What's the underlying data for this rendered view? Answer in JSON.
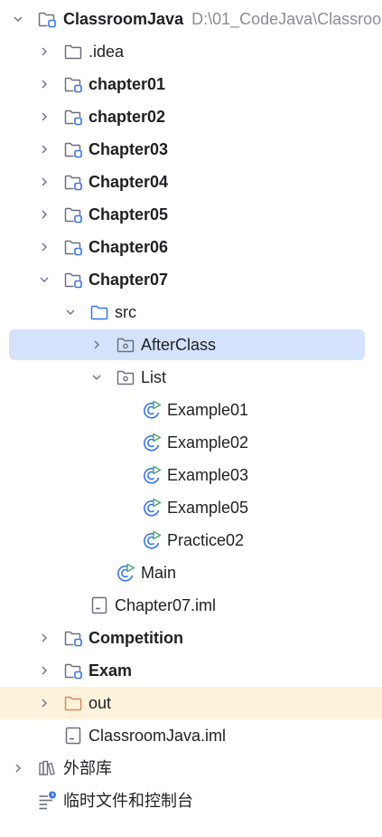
{
  "colors": {
    "selection": "#d4e2fb",
    "excluded_bg": "#fdf3dc",
    "folder_stroke": "#6c707e",
    "module_badge": "#3574f0",
    "excluded_folder": "#e08855",
    "run_class": "#3574f0",
    "run_triangle": "#55a76a",
    "path_text": "#8a8d93"
  },
  "project_tree": {
    "root": {
      "label": "ClassroomJava",
      "path": "D:\\01_CodeJava\\Classroo",
      "icon": "module-folder-icon"
    },
    "folder_idea": {
      "label": ".idea",
      "icon": "folder-icon"
    },
    "chapter01": {
      "label": "chapter01",
      "icon": "module-folder-icon"
    },
    "chapter02": {
      "label": "chapter02",
      "icon": "module-folder-icon"
    },
    "chapter03": {
      "label": "Chapter03",
      "icon": "module-folder-icon"
    },
    "chapter04": {
      "label": "Chapter04",
      "icon": "module-folder-icon"
    },
    "chapter05": {
      "label": "Chapter05",
      "icon": "module-folder-icon"
    },
    "chapter06": {
      "label": "Chapter06",
      "icon": "module-folder-icon"
    },
    "chapter07": {
      "label": "Chapter07",
      "icon": "module-folder-icon"
    },
    "src": {
      "label": "src",
      "icon": "source-folder-icon"
    },
    "afterclass": {
      "label": "AfterClass",
      "icon": "package-icon"
    },
    "list": {
      "label": "List",
      "icon": "package-icon"
    },
    "example01": {
      "label": "Example01",
      "icon": "runnable-class-icon"
    },
    "example02": {
      "label": "Example02",
      "icon": "runnable-class-icon"
    },
    "example03": {
      "label": "Example03",
      "icon": "runnable-class-icon"
    },
    "example05": {
      "label": "Example05",
      "icon": "runnable-class-icon"
    },
    "practice02": {
      "label": "Practice02",
      "icon": "runnable-class-icon"
    },
    "main_class": {
      "label": "Main",
      "icon": "runnable-class-icon"
    },
    "chapter07_iml": {
      "label": "Chapter07.iml",
      "icon": "iml-file-icon"
    },
    "competition": {
      "label": "Competition",
      "icon": "module-folder-icon"
    },
    "exam": {
      "label": "Exam",
      "icon": "module-folder-icon"
    },
    "out": {
      "label": "out",
      "icon": "excluded-folder-icon"
    },
    "classroom_iml": {
      "label": "ClassroomJava.iml",
      "icon": "iml-file-icon"
    },
    "external_libs": {
      "label": "外部库",
      "icon": "library-icon"
    },
    "scratches": {
      "label": "临时文件和控制台",
      "icon": "scratches-icon"
    }
  }
}
